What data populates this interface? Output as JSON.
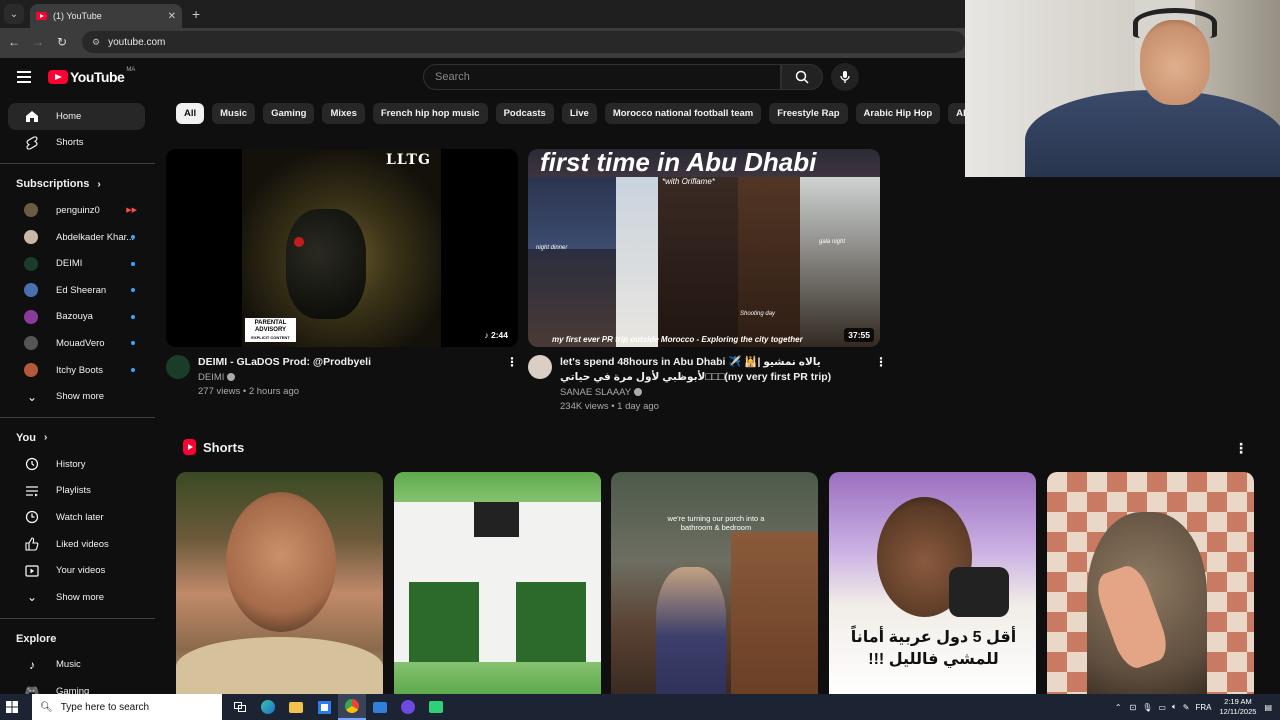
{
  "browser": {
    "tab_title": "(1) YouTube",
    "url": "youtube.com"
  },
  "header": {
    "logo_text": "YouTube",
    "region": "MA",
    "search_placeholder": "Search"
  },
  "sidebar": {
    "top": [
      {
        "label": "Home",
        "icon": "home-icon",
        "active": true
      },
      {
        "label": "Shorts",
        "icon": "shorts-icon"
      }
    ],
    "subscriptions_title": "Subscriptions",
    "subscriptions": [
      {
        "label": "penguinz0",
        "color": "#6b5b45",
        "indicator": "live"
      },
      {
        "label": "Abdelkader Khar...",
        "color": "#c9b8a8",
        "indicator": "dot"
      },
      {
        "label": "DEIMI",
        "color": "#1a3d2a",
        "indicator": "dot"
      },
      {
        "label": "Ed Sheeran",
        "color": "#4a6fb0",
        "indicator": "dot"
      },
      {
        "label": "Bazouya",
        "color": "#8a3a9a",
        "indicator": "dot"
      },
      {
        "label": "MouadVero",
        "color": "#3a3a3a",
        "indicator": "dot"
      },
      {
        "label": "Itchy Boots",
        "color": "#b05a3a",
        "indicator": "dot"
      }
    ],
    "subs_show_more": "Show more",
    "you_title": "You",
    "you_items": [
      {
        "label": "History",
        "icon": "history-icon"
      },
      {
        "label": "Playlists",
        "icon": "playlists-icon"
      },
      {
        "label": "Watch later",
        "icon": "watch-later-icon"
      },
      {
        "label": "Liked videos",
        "icon": "like-icon"
      },
      {
        "label": "Your videos",
        "icon": "your-videos-icon"
      }
    ],
    "you_show_more": "Show more",
    "explore_title": "Explore",
    "explore_items": [
      {
        "label": "Music",
        "icon": "music-icon"
      },
      {
        "label": "Gaming",
        "icon": "gaming-icon"
      }
    ]
  },
  "chips": [
    "All",
    "Music",
    "Gaming",
    "Mixes",
    "French hip hop music",
    "Podcasts",
    "Live",
    "Morocco national football team",
    "Freestyle Rap",
    "Arabic Hip Hop",
    "Albums"
  ],
  "videos": [
    {
      "title": "DEIMI - GLaDOS Prod: @Prodbyeli",
      "channel": "DEIMI",
      "stats": "277 views • 2 hours ago",
      "duration": "2:44",
      "thumb_text": "LLTG",
      "advisory": "PARENTAL ADVISORY",
      "advisory_sub": "EXPLICIT CONTENT"
    },
    {
      "title": "let's spend 48hours in Abu Dhabi ✈️ 🕌| يالاه نمشيو لأبوظبي لأول مرة في حياتي□□□(my very first PR trip)",
      "channel": "SANAE SLAAAY",
      "stats": "234K views • 1 day ago",
      "duration": "37:55",
      "thumb_title": "first time in Abu Dhabi",
      "thumb_sub": "*with Oriflame*",
      "thumb_caption": "my first ever PR trip outside Morocco - Exploring the city together",
      "thumb_labels": [
        "night dinner",
        "gala night",
        "Shooting day"
      ]
    }
  ],
  "shorts": {
    "title": "Shorts",
    "items": [
      {
        "overlay": ""
      },
      {
        "overlay": ""
      },
      {
        "overlay": "we're turning our porch into a bathroom & bedroom"
      },
      {
        "overlay": "أقل 5 دول عربية أماناً للمشي فالليل !!!"
      },
      {
        "overlay": ""
      }
    ]
  },
  "taskbar": {
    "search_placeholder": "Type here to search",
    "lang": "FRA",
    "time": "2:19 AM",
    "date": "12/11/2025"
  }
}
